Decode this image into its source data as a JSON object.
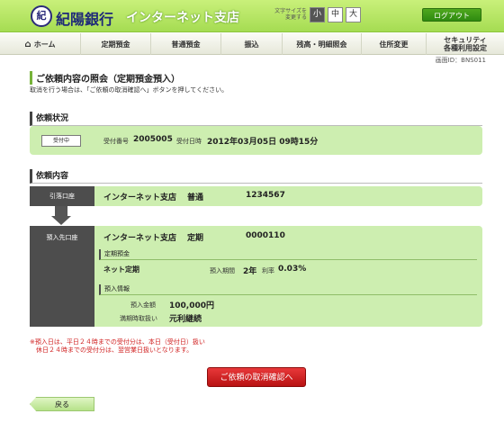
{
  "header": {
    "logo_glyph": "紀",
    "bank_name": "紀陽銀行",
    "shop_name": "インターネット支店",
    "font_size_label": "文字サイズを\n変更する",
    "font_sizes": [
      "小",
      "中",
      "大"
    ],
    "logout_label": "ログアウト"
  },
  "nav": {
    "home_icon": "home-icon",
    "items": [
      "ホーム",
      "定期預金",
      "普通預金",
      "振込",
      "残高・明細照会",
      "住所変更",
      "セキュリティ\n各種利用設定"
    ]
  },
  "screen_id": "画面ID：BNS011",
  "page": {
    "title": "ご依頼内容の照会（定期預金預入）",
    "guide": "取消を行う場合は、「ご依頼の取消確認へ」ボタンを押してください。"
  },
  "status": {
    "heading": "依頼状況",
    "badge": "受付中",
    "receipt_no_label": "受付番号",
    "receipt_no": "2005005",
    "receipt_dt_label": "受付日時",
    "receipt_dt": "2012年03月05日 09時15分"
  },
  "request": {
    "heading": "依頼内容",
    "source": {
      "label": "引落口座",
      "branch": "インターネット支店",
      "type": "普通",
      "account": "1234567"
    },
    "dest": {
      "label": "預入先口座",
      "branch": "インターネット支店",
      "type": "定期",
      "account": "0000110"
    },
    "deposit": {
      "heading": "定期預金",
      "product": "ネット定期",
      "term_label": "預入期間",
      "term": "2年",
      "rate_label": "利率",
      "rate": "0.03%"
    },
    "info": {
      "heading": "預入情報",
      "amount_label": "預入金額",
      "amount": "100,000円",
      "maturity_label": "満期時取扱い",
      "maturity": "元利継続"
    }
  },
  "note": "※預入日は、平日２４時までの受付分は、本日（受付日）扱い\n　休日２４時までの受付分は、翌営業日扱いとなります。",
  "buttons": {
    "cancel": "ご依頼の取消確認へ",
    "back": "戻る"
  }
}
